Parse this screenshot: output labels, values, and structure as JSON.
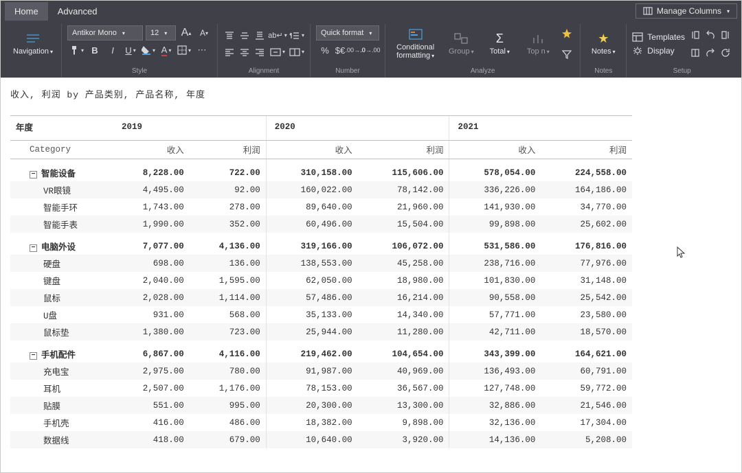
{
  "tabs": {
    "home": "Home",
    "advanced": "Advanced"
  },
  "manage_columns": "Manage Columns",
  "groups": {
    "navigation": "Navigation",
    "style": "Style",
    "alignment": "Alignment",
    "number": "Number",
    "analyze": "Analyze",
    "notes": "Notes",
    "setup": "Setup"
  },
  "font": {
    "name": "Antikor Mono",
    "size": "12"
  },
  "quick_format": "Quick format",
  "analyze": {
    "cond": "Conditional formatting",
    "group": "Group",
    "total": "Total",
    "topn": "Top n"
  },
  "notes_btn": "Notes",
  "setup": {
    "templates": "Templates",
    "display": "Display"
  },
  "report": {
    "title": "收入, 利润 by 产品类别, 产品名称, 年度",
    "year_label": "年度",
    "category_label": "Category",
    "years": [
      "2019",
      "2020",
      "2021"
    ],
    "metrics": [
      "收入",
      "利润"
    ],
    "categories": [
      {
        "name": "智能设备",
        "totals": [
          "8,228.00",
          "722.00",
          "310,158.00",
          "115,606.00",
          "578,054.00",
          "224,558.00"
        ],
        "rows": [
          {
            "name": "VR眼镜",
            "vals": [
              "4,495.00",
              "92.00",
              "160,022.00",
              "78,142.00",
              "336,226.00",
              "164,186.00"
            ]
          },
          {
            "name": "智能手环",
            "vals": [
              "1,743.00",
              "278.00",
              "89,640.00",
              "21,960.00",
              "141,930.00",
              "34,770.00"
            ]
          },
          {
            "name": "智能手表",
            "vals": [
              "1,990.00",
              "352.00",
              "60,496.00",
              "15,504.00",
              "99,898.00",
              "25,602.00"
            ]
          }
        ]
      },
      {
        "name": "电脑外设",
        "totals": [
          "7,077.00",
          "4,136.00",
          "319,166.00",
          "106,072.00",
          "531,586.00",
          "176,816.00"
        ],
        "rows": [
          {
            "name": "硬盘",
            "vals": [
              "698.00",
              "136.00",
              "138,553.00",
              "45,258.00",
              "238,716.00",
              "77,976.00"
            ]
          },
          {
            "name": "键盘",
            "vals": [
              "2,040.00",
              "1,595.00",
              "62,050.00",
              "18,980.00",
              "101,830.00",
              "31,148.00"
            ]
          },
          {
            "name": "鼠标",
            "vals": [
              "2,028.00",
              "1,114.00",
              "57,486.00",
              "16,214.00",
              "90,558.00",
              "25,542.00"
            ]
          },
          {
            "name": "U盘",
            "vals": [
              "931.00",
              "568.00",
              "35,133.00",
              "14,340.00",
              "57,771.00",
              "23,580.00"
            ]
          },
          {
            "name": "鼠标垫",
            "vals": [
              "1,380.00",
              "723.00",
              "25,944.00",
              "11,280.00",
              "42,711.00",
              "18,570.00"
            ]
          }
        ]
      },
      {
        "name": "手机配件",
        "totals": [
          "6,867.00",
          "4,116.00",
          "219,462.00",
          "104,654.00",
          "343,399.00",
          "164,621.00"
        ],
        "rows": [
          {
            "name": "充电宝",
            "vals": [
              "2,975.00",
              "780.00",
              "91,987.00",
              "40,969.00",
              "136,493.00",
              "60,791.00"
            ]
          },
          {
            "name": "耳机",
            "vals": [
              "2,507.00",
              "1,176.00",
              "78,153.00",
              "36,567.00",
              "127,748.00",
              "59,772.00"
            ]
          },
          {
            "name": "贴膜",
            "vals": [
              "551.00",
              "995.00",
              "20,300.00",
              "13,300.00",
              "32,886.00",
              "21,546.00"
            ]
          },
          {
            "name": "手机壳",
            "vals": [
              "416.00",
              "486.00",
              "18,382.00",
              "9,898.00",
              "32,136.00",
              "17,304.00"
            ]
          },
          {
            "name": "数据线",
            "vals": [
              "418.00",
              "679.00",
              "10,640.00",
              "3,920.00",
              "14,136.00",
              "5,208.00"
            ]
          }
        ]
      }
    ]
  },
  "chart_data": {
    "type": "table",
    "title": "收入, 利润 by 产品类别, 产品名称, 年度",
    "columns": [
      "产品类别",
      "产品名称",
      "年度",
      "收入",
      "利润"
    ],
    "data": [
      [
        "智能设备",
        "VR眼镜",
        "2019",
        4495.0,
        92.0
      ],
      [
        "智能设备",
        "VR眼镜",
        "2020",
        160022.0,
        78142.0
      ],
      [
        "智能设备",
        "VR眼镜",
        "2021",
        336226.0,
        164186.0
      ],
      [
        "智能设备",
        "智能手环",
        "2019",
        1743.0,
        278.0
      ],
      [
        "智能设备",
        "智能手环",
        "2020",
        89640.0,
        21960.0
      ],
      [
        "智能设备",
        "智能手环",
        "2021",
        141930.0,
        34770.0
      ],
      [
        "智能设备",
        "智能手表",
        "2019",
        1990.0,
        352.0
      ],
      [
        "智能设备",
        "智能手表",
        "2020",
        60496.0,
        15504.0
      ],
      [
        "智能设备",
        "智能手表",
        "2021",
        99898.0,
        25602.0
      ],
      [
        "电脑外设",
        "硬盘",
        "2019",
        698.0,
        136.0
      ],
      [
        "电脑外设",
        "硬盘",
        "2020",
        138553.0,
        45258.0
      ],
      [
        "电脑外设",
        "硬盘",
        "2021",
        238716.0,
        77976.0
      ],
      [
        "电脑外设",
        "键盘",
        "2019",
        2040.0,
        1595.0
      ],
      [
        "电脑外设",
        "键盘",
        "2020",
        62050.0,
        18980.0
      ],
      [
        "电脑外设",
        "键盘",
        "2021",
        101830.0,
        31148.0
      ],
      [
        "电脑外设",
        "鼠标",
        "2019",
        2028.0,
        1114.0
      ],
      [
        "电脑外设",
        "鼠标",
        "2020",
        57486.0,
        16214.0
      ],
      [
        "电脑外设",
        "鼠标",
        "2021",
        90558.0,
        25542.0
      ],
      [
        "电脑外设",
        "U盘",
        "2019",
        931.0,
        568.0
      ],
      [
        "电脑外设",
        "U盘",
        "2020",
        35133.0,
        14340.0
      ],
      [
        "电脑外设",
        "U盘",
        "2021",
        57771.0,
        23580.0
      ],
      [
        "电脑外设",
        "鼠标垫",
        "2019",
        1380.0,
        723.0
      ],
      [
        "电脑外设",
        "鼠标垫",
        "2020",
        25944.0,
        11280.0
      ],
      [
        "电脑外设",
        "鼠标垫",
        "2021",
        42711.0,
        18570.0
      ],
      [
        "手机配件",
        "充电宝",
        "2019",
        2975.0,
        780.0
      ],
      [
        "手机配件",
        "充电宝",
        "2020",
        91987.0,
        40969.0
      ],
      [
        "手机配件",
        "充电宝",
        "2021",
        136493.0,
        60791.0
      ],
      [
        "手机配件",
        "耳机",
        "2019",
        2507.0,
        1176.0
      ],
      [
        "手机配件",
        "耳机",
        "2020",
        78153.0,
        36567.0
      ],
      [
        "手机配件",
        "耳机",
        "2021",
        127748.0,
        59772.0
      ],
      [
        "手机配件",
        "贴膜",
        "2019",
        551.0,
        995.0
      ],
      [
        "手机配件",
        "贴膜",
        "2020",
        20300.0,
        13300.0
      ],
      [
        "手机配件",
        "贴膜",
        "2021",
        32886.0,
        21546.0
      ],
      [
        "手机配件",
        "手机壳",
        "2019",
        416.0,
        486.0
      ],
      [
        "手机配件",
        "手机壳",
        "2020",
        18382.0,
        9898.0
      ],
      [
        "手机配件",
        "手机壳",
        "2021",
        32136.0,
        17304.0
      ],
      [
        "手机配件",
        "数据线",
        "2019",
        418.0,
        679.0
      ],
      [
        "手机配件",
        "数据线",
        "2020",
        10640.0,
        3920.0
      ],
      [
        "手机配件",
        "数据线",
        "2021",
        14136.0,
        5208.0
      ]
    ]
  }
}
